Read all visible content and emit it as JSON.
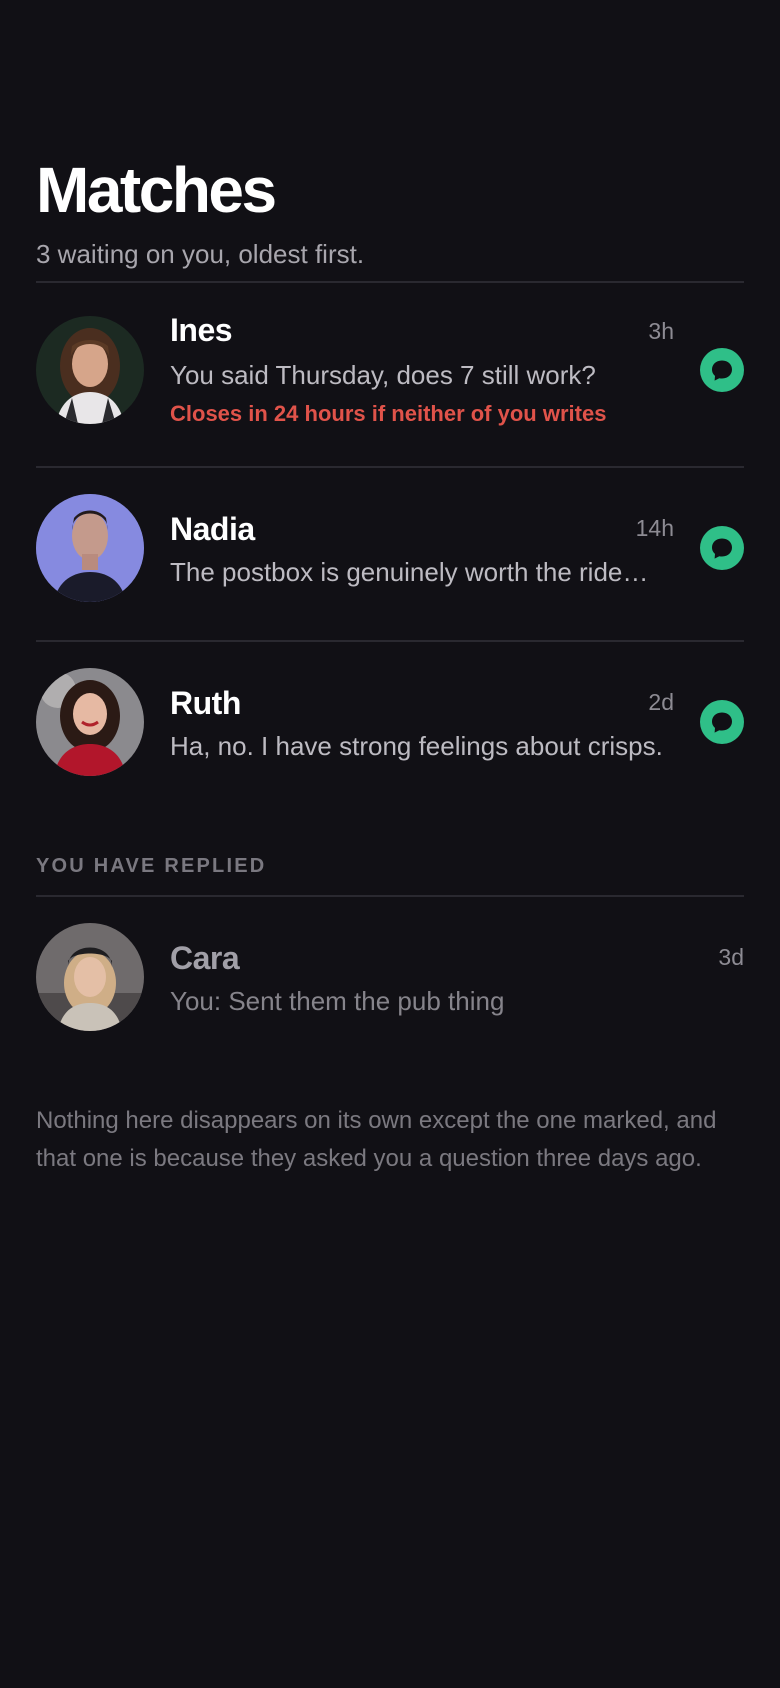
{
  "header": {
    "title": "Matches",
    "subtitle": "3 waiting on you, oldest first."
  },
  "waiting": [
    {
      "name": "Ines",
      "time": "3h",
      "preview": "You said Thursday, does 7 still work?",
      "warning": "Closes in 24 hours if neither of you writes"
    },
    {
      "name": "Nadia",
      "time": "14h",
      "preview": "The postbox is genuinely worth the ride…"
    },
    {
      "name": "Ruth",
      "time": "2d",
      "preview": "Ha, no. I have strong feelings about crisps."
    }
  ],
  "replied_section": {
    "label": "YOU HAVE REPLIED",
    "items": [
      {
        "name": "Cara",
        "time": "3d",
        "preview": "You: Sent them the pub thing"
      }
    ]
  },
  "footnote": "Nothing here disappears on its own except the one marked, and that one is because they asked you a question three days ago.",
  "colors": {
    "background": "#111015",
    "accent": "#2fbf88",
    "warning": "#e0534a"
  },
  "icons": {
    "reply": "chat-bubble-icon"
  }
}
